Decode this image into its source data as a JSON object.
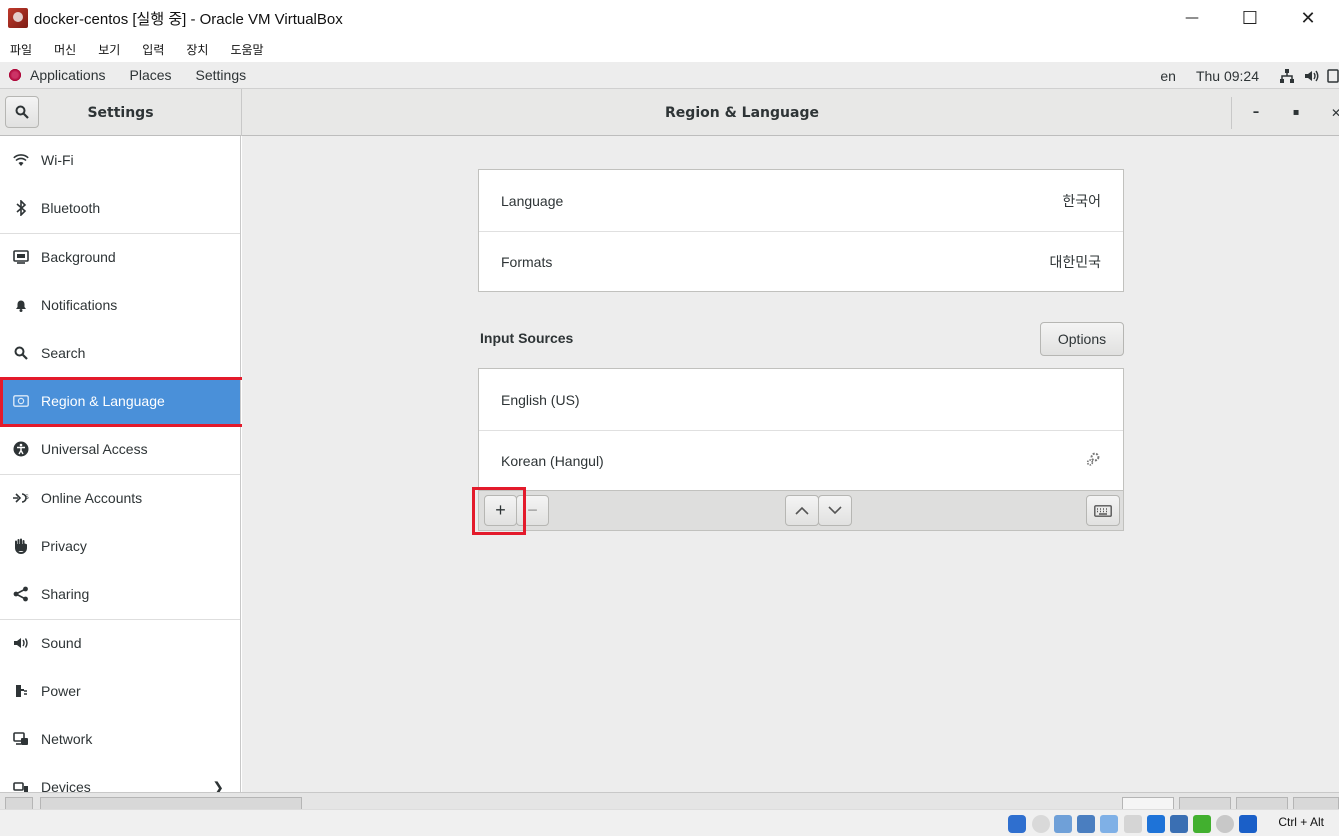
{
  "host": {
    "window_title": "docker-centos [실행 중] - Oracle VM VirtualBox",
    "minimize": "—",
    "maximize": "☐",
    "close": "✕",
    "menu": [
      "파일",
      "머신",
      "보기",
      "입력",
      "장치",
      "도움말"
    ]
  },
  "gnome_bar": {
    "applications": "Applications",
    "places": "Places",
    "settings": "Settings",
    "lang": "en",
    "clock": "Thu 09:24"
  },
  "settings_header": {
    "sidebar_title": "Settings",
    "main_title": "Region & Language",
    "minimize": "–",
    "maximize": "▪",
    "close": "✕"
  },
  "sidebar": {
    "items": [
      {
        "label": "Wi-Fi",
        "icon": "wifi-icon"
      },
      {
        "label": "Bluetooth",
        "icon": "bluetooth-icon"
      },
      {
        "label": "Background",
        "icon": "background-icon"
      },
      {
        "label": "Notifications",
        "icon": "bell-icon"
      },
      {
        "label": "Search",
        "icon": "search-icon"
      },
      {
        "label": "Region & Language",
        "icon": "region-icon"
      },
      {
        "label": "Universal Access",
        "icon": "accessibility-icon"
      },
      {
        "label": "Online Accounts",
        "icon": "online-accounts-icon"
      },
      {
        "label": "Privacy",
        "icon": "hand-icon"
      },
      {
        "label": "Sharing",
        "icon": "share-icon"
      },
      {
        "label": "Sound",
        "icon": "speaker-icon"
      },
      {
        "label": "Power",
        "icon": "power-icon"
      },
      {
        "label": "Network",
        "icon": "network-icon"
      },
      {
        "label": "Devices",
        "icon": "devices-icon"
      }
    ],
    "selected_index": 5
  },
  "region": {
    "language_label": "Language",
    "language_value": "한국어",
    "formats_label": "Formats",
    "formats_value": "대한민국",
    "input_sources_title": "Input Sources",
    "options_label": "Options",
    "sources": [
      "English (US)",
      "Korean (Hangul)"
    ],
    "add_label": "+",
    "remove_label": "−"
  },
  "taskbar": {
    "host_key": "Ctrl + Alt"
  },
  "colors": {
    "selected": "#4a90d9",
    "highlight": "#e31a2b"
  }
}
